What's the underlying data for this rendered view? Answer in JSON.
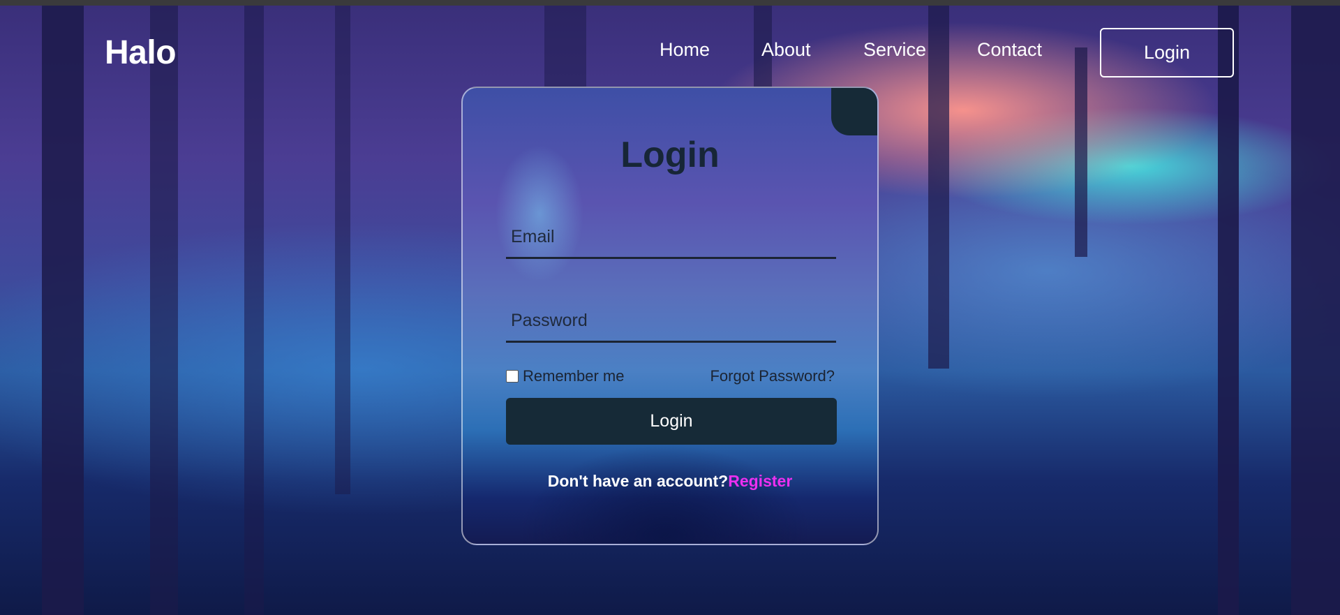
{
  "header": {
    "brand": "Halo",
    "nav": [
      {
        "label": "Home"
      },
      {
        "label": "About"
      },
      {
        "label": "Service"
      },
      {
        "label": "Contact"
      }
    ],
    "login_button": "Login"
  },
  "login_card": {
    "title": "Login",
    "email_placeholder": "Email",
    "password_placeholder": "Password",
    "remember_label": "Remember me",
    "remember_checked": false,
    "forgot_label": "Forgot Password?",
    "submit_label": "Login",
    "register_prompt": "Don't have an account?",
    "register_link": "Register"
  },
  "colors": {
    "accent": "#162a37",
    "link": "#ec2ff0"
  }
}
